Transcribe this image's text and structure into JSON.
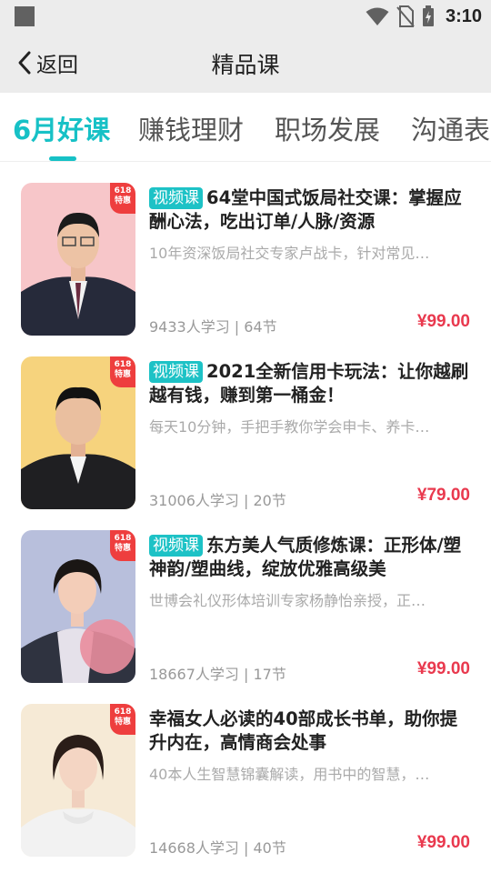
{
  "status_bar": {
    "time": "3:10",
    "icons": [
      "wifi-icon",
      "no-sim-icon",
      "battery-charging-icon"
    ]
  },
  "nav": {
    "back_label": "返回",
    "title": "精品课"
  },
  "tabs": [
    {
      "label": "6月好课",
      "active": true
    },
    {
      "label": "赚钱理财",
      "active": false
    },
    {
      "label": "职场发展",
      "active": false
    },
    {
      "label": "沟通表",
      "active": false
    }
  ],
  "colors": {
    "accent": "#17c1c6",
    "price": "#e9394e",
    "badge": "#ee3e3e"
  },
  "courses": [
    {
      "badge": "618 特惠",
      "tag": "视频课",
      "title": "64堂中国式饭局社交课：掌握应酬心法，吃出订单/人脉/资源",
      "desc": "10年资深饭局社交专家卢战卡，针对常见…",
      "meta": "9433人学习 | 64节",
      "price": "¥99.00"
    },
    {
      "badge": "618 特惠",
      "tag": "视频课",
      "title": "2021全新信用卡玩法：让你越刷越有钱，赚到第一桶金！",
      "desc": "每天10分钟，手把手教你学会申卡、养卡…",
      "meta": "31006人学习 | 20节",
      "price": "¥79.00"
    },
    {
      "badge": "618 特惠",
      "tag": "视频课",
      "title": "东方美人气质修炼课：正形体/塑神韵/塑曲线，绽放优雅高级美",
      "desc": "世博会礼仪形体培训专家杨静怡亲授，正…",
      "meta": "18667人学习 | 17节",
      "price": "¥99.00"
    },
    {
      "badge": "618 特惠",
      "tag": "",
      "title": "幸福女人必读的40部成长书单，助你提升内在，高情商会处事",
      "desc": "40本人生智慧锦囊解读，用书中的智慧，…",
      "meta": "14668人学习 | 40节",
      "price": "¥99.00"
    }
  ]
}
